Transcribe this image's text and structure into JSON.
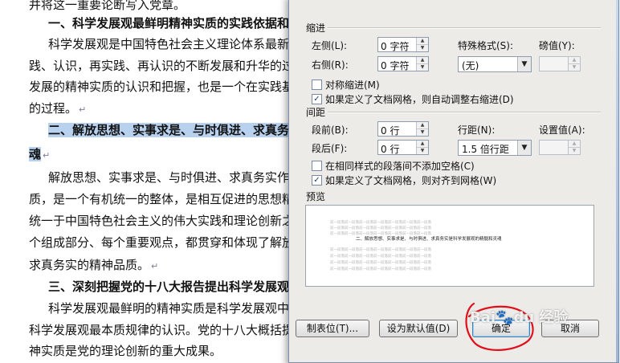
{
  "document": {
    "lines": [
      {
        "text": "并将这一重要论断写入党章。",
        "pm": false,
        "heading": false,
        "hl": false
      },
      {
        "text": "一、科学发展观最鲜明精神实质的实践依据和理",
        "pm": false,
        "heading": true,
        "hl": false
      },
      {
        "text": "科学发展观是中国特色社会主义理论体系最新成",
        "pm": false,
        "heading": false,
        "hl": false
      },
      {
        "text": "践、认识，再实践、再认识的不断发展和升华的过程",
        "pm": false,
        "heading": false,
        "hl": false
      },
      {
        "text": "发展的精神实质的认识和把握，也是一个在实践基础",
        "pm": false,
        "heading": false,
        "hl": false
      },
      {
        "text": "的过程。",
        "pm": true,
        "heading": false,
        "hl": false
      },
      {
        "text": "二、解放思想、实事求是、与时俱进、求真务实",
        "pm": false,
        "heading": true,
        "hl": true
      },
      {
        "text": "魂",
        "pm": true,
        "heading": true,
        "hl": true
      },
      {
        "text": "解放思想、实事求是、与时俱进、求真务实作为",
        "pm": false,
        "heading": false,
        "hl": false
      },
      {
        "text": "质，是一个有机统一的整体，是相互促进的思想精髓",
        "pm": false,
        "heading": false,
        "hl": false
      },
      {
        "text": "统一于中国特色社会主义的伟大实践和理论创新之中",
        "pm": false,
        "heading": false,
        "hl": false
      },
      {
        "text": "个组成部分、每个重要观点，都贯穿和体现了解放思",
        "pm": false,
        "heading": false,
        "hl": false
      },
      {
        "text": "求真务实的精神品质。",
        "pm": true,
        "heading": false,
        "hl": false
      },
      {
        "text": "三、深刻把握党的十八大报告提出科学发展观最",
        "pm": false,
        "heading": true,
        "hl": false
      },
      {
        "text": "科学发展观最鲜明的精神实质是科学发展观中起",
        "pm": false,
        "heading": false,
        "hl": false
      },
      {
        "text": "科学发展观最本质规律的认识。党的十八大概括提炼",
        "pm": false,
        "heading": false,
        "hl": false
      },
      {
        "text": "神实质是党的理论创新的重大成果。",
        "pm": false,
        "heading": false,
        "hl": false
      }
    ],
    "para_mark": "↵"
  },
  "dialog": {
    "indent_section": "缩进",
    "left_label": "左侧(L):",
    "left_value": "0 字符",
    "right_label": "右侧(R):",
    "right_value": "0 字符",
    "special_label": "特殊格式(S):",
    "special_value": "(无)",
    "by_label": "磅值(Y):",
    "by_value": "",
    "mirror_indent": "对称缩进(M)",
    "mirror_indent_checked": false,
    "auto_adjust_right": "如果定义了文档网格，则自动调整右缩进(D)",
    "auto_adjust_right_checked": true,
    "spacing_section": "间距",
    "before_label": "段前(B):",
    "before_value": "0 行",
    "after_label": "段后(F):",
    "after_value": "0 行",
    "line_spacing_label": "行距(N):",
    "line_spacing_value": "1.5 倍行距",
    "at_label": "设置值(A):",
    "at_value": "",
    "no_space_same_style": "在相同样式的段落间不添加空格(C)",
    "no_space_same_style_checked": false,
    "snap_to_grid": "如果定义了文档网格，则对齐到网格(W)",
    "snap_to_grid_checked": true,
    "preview_label": "预览",
    "preview_sample_text": "二、解放思想、实事求是、与时俱进、求真务实是科学发展观的精髓和灵魂",
    "filler_text": "前一段落前一段落前一段落前一段落前一段落前一段落前一段落",
    "tabs_button": "制表位(T)...",
    "default_button": "设为默认值(D)",
    "ok_button": "确定",
    "cancel_button": "取消",
    "check_mark": "✓"
  },
  "watermark_text": "Bai du 经验",
  "colors": {
    "highlight": "#b7d1ee",
    "dialog_bg": "#ecebe8",
    "annotation_red": "#e0101a"
  }
}
